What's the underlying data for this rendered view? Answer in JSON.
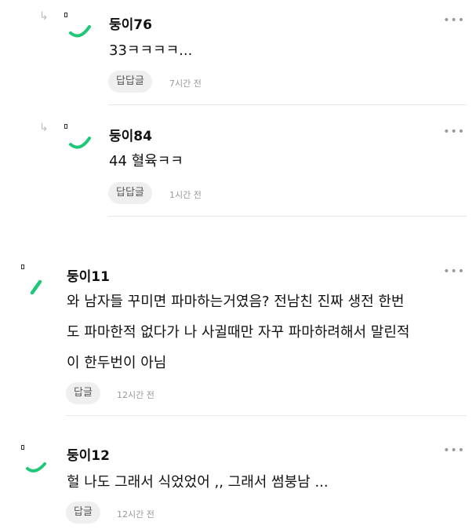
{
  "comments": [
    {
      "name": "둥이76",
      "text": "33ㅋㅋㅋㅋ...",
      "reply_label": "답답글",
      "time": "7시간 전"
    },
    {
      "name": "둥이84",
      "text": "44 혈육ㅋㅋ",
      "reply_label": "답답글",
      "time": "1시간 전"
    },
    {
      "name": "둥이11",
      "text_lines": [
        "와 남자들 꾸미면 파마하는거였음? 전남친 진짜 생전 한번",
        "도 파마한적 없다가 나 사귈때만 자꾸 파마하려해서 말린적",
        "이 한두번이 아님"
      ],
      "reply_label": "답글",
      "time": "12시간 전"
    },
    {
      "name": "둥이12",
      "text": "헐 나도 그래서 식었었어 ,, 그래서 썸붕남 ...",
      "reply_label": "답글",
      "time": "12시간 전"
    }
  ],
  "more_label": "•••",
  "reply_arrow": "↳",
  "colors": {
    "accent_green": "#1ec877",
    "divider": "#e8e8e8",
    "button_bg": "#efefef"
  }
}
